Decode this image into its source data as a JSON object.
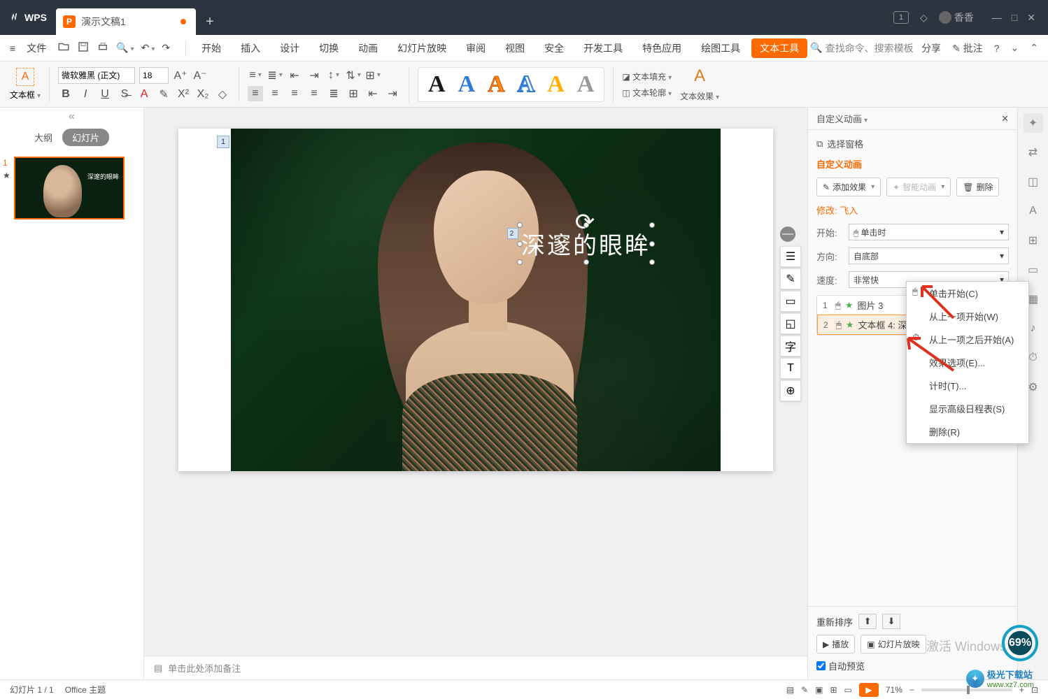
{
  "title": {
    "app": "WPS",
    "tab": "演示文稿1"
  },
  "win": {
    "user": "香香"
  },
  "menu": {
    "file": "文件",
    "items": [
      "开始",
      "插入",
      "设计",
      "切换",
      "动画",
      "幻灯片放映",
      "审阅",
      "视图",
      "安全",
      "开发工具",
      "特色应用",
      "绘图工具",
      "文本工具"
    ],
    "active": "文本工具",
    "search": "查找命令、搜索模板",
    "share": "分享",
    "comment": "批注"
  },
  "ribbon": {
    "font": "微软雅黑 (正文)",
    "size": "18",
    "textbox": "文本框",
    "fill": "文本填充",
    "outline": "文本轮廓",
    "effect": "文本效果"
  },
  "slidepanel": {
    "outline": "大纲",
    "slides": "幻灯片",
    "num": "1",
    "star": "★",
    "thumb_text": "深邃的眼眸"
  },
  "slide": {
    "seq1": "1",
    "seq2": "2",
    "text": "深邃的眼眸"
  },
  "notes": "单击此处添加备注",
  "side": {
    "title": "自定义动画",
    "pane": "选择窗格",
    "section": "自定义动画",
    "add": "添加效果",
    "smart": "智能动画",
    "delete": "删除",
    "modify": "修改: 飞入",
    "start_l": "开始:",
    "start_v": "单击时",
    "dir_l": "方向:",
    "dir_v": "自底部",
    "speed_l": "速度:",
    "speed_v": "非常快",
    "item1": "图片 3",
    "item2": "文本框 4: 深邃的眼眸",
    "menu": [
      "单击开始(C)",
      "从上一项开始(W)",
      "从上一项之后开始(A)",
      "效果选项(E)...",
      "计时(T)...",
      "显示高级日程表(S)",
      "删除(R)"
    ],
    "reorder": "重新排序",
    "play": "播放",
    "slideshow": "幻灯片放映",
    "autoprev": "自动预览"
  },
  "status": {
    "page": "幻灯片 1 / 1",
    "theme": "Office 主题",
    "zoom": "71%"
  },
  "progress": "69%",
  "wm": "极光下载站",
  "wm2": "www.xz7.com",
  "activate": "激活 Windows"
}
